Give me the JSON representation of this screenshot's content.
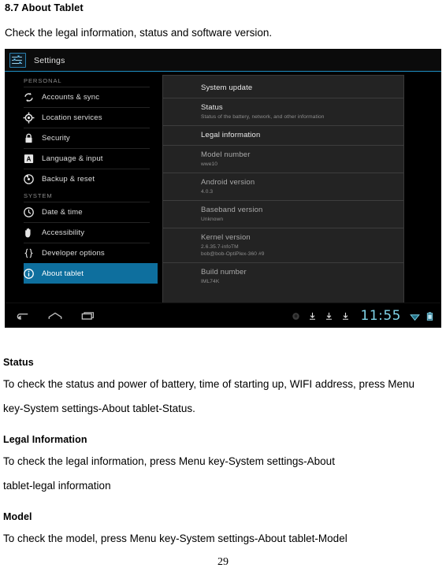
{
  "document": {
    "title_heading": "8.7 About Tablet",
    "intro_paragraph": "Check the legal information, status and software version.",
    "sections": [
      {
        "heading": "Status",
        "body": "To check the status and power of battery, time of starting up, WIFI address, press Menu key-System settings-About tablet-Status."
      },
      {
        "heading": "Legal Information",
        "body_line1": "To check the legal information, press Menu key-System settings-About",
        "body_line2": "tablet-legal information"
      },
      {
        "heading": "Model",
        "body": "To check the model, press Menu key-System settings-About tablet-Model"
      }
    ],
    "page_number": "29"
  },
  "screenshot": {
    "titlebar": {
      "app_icon": "settings-sliders-icon",
      "app_title": "Settings",
      "accent_color": "#1f8fc4"
    },
    "sidebar": {
      "groups": [
        {
          "label": "PERSONAL",
          "items": [
            {
              "label": "Accounts & sync",
              "icon": "sync-icon",
              "selected": false
            },
            {
              "label": "Location services",
              "icon": "location-icon",
              "selected": false
            },
            {
              "label": "Security",
              "icon": "lock-icon",
              "selected": false
            },
            {
              "label": "Language & input",
              "icon": "language-icon",
              "selected": false
            },
            {
              "label": "Backup & reset",
              "icon": "backup-icon",
              "selected": false
            }
          ]
        },
        {
          "label": "SYSTEM",
          "items": [
            {
              "label": "Date & time",
              "icon": "clock-icon",
              "selected": false
            },
            {
              "label": "Accessibility",
              "icon": "hand-icon",
              "selected": false
            },
            {
              "label": "Developer options",
              "icon": "braces-icon",
              "selected": false
            },
            {
              "label": "About tablet",
              "icon": "info-icon",
              "selected": true
            }
          ]
        }
      ],
      "selected_color": "#0e6f9e"
    },
    "detail": {
      "rows": [
        {
          "title": "System update",
          "subtitle": ""
        },
        {
          "title": "Status",
          "subtitle": "Status of the battery, network, and other information"
        },
        {
          "title": "Legal information",
          "subtitle": ""
        },
        {
          "title": "Model number",
          "subtitle": "wwe10"
        },
        {
          "title": "Android version",
          "subtitle": "4.0.3"
        },
        {
          "title": "Baseband version",
          "subtitle": "Unknown"
        },
        {
          "title": "Kernel version",
          "subtitle": "2.6.35.7-infoTM\nbob@bob-OptiPlex-360 #9"
        },
        {
          "title": "Build number",
          "subtitle": "IML74K"
        }
      ]
    },
    "systembar": {
      "nav": [
        {
          "icon": "back-icon"
        },
        {
          "icon": "home-icon"
        },
        {
          "icon": "recents-icon"
        }
      ],
      "status": [
        {
          "icon": "circle-notification-icon"
        },
        {
          "icon": "download-icon"
        },
        {
          "icon": "download-icon"
        },
        {
          "icon": "download-icon"
        }
      ],
      "clock": "11:55",
      "trailing": [
        {
          "icon": "wifi-icon"
        },
        {
          "icon": "battery-icon"
        }
      ],
      "clock_color": "#7fd4e8"
    }
  }
}
